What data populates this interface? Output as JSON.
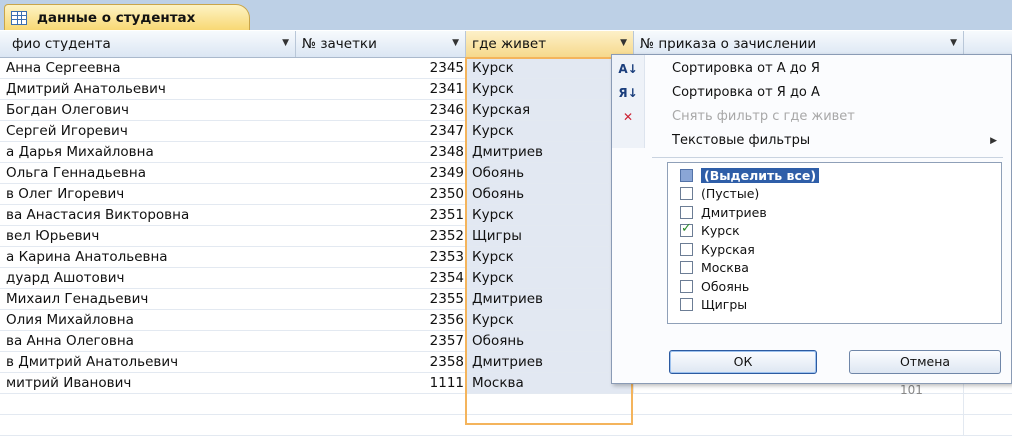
{
  "tab": {
    "label": "данные о студентах"
  },
  "columns": {
    "name": "фио студента",
    "number": "№ зачетки",
    "city": "где живет",
    "order": "№ приказа о зачислении"
  },
  "rows": [
    {
      "name": "Анна Сергеевна",
      "number": "2345",
      "city": "Курск"
    },
    {
      "name": "Дмитрий Анатольевич",
      "number": "2341",
      "city": "Курск"
    },
    {
      "name": " Богдан Олегович",
      "number": "2346",
      "city": "Курская"
    },
    {
      "name": "Сергей Игоревич",
      "number": "2347",
      "city": "Курск"
    },
    {
      "name": "а Дарья Михайловна",
      "number": "2348",
      "city": "Дмитриев"
    },
    {
      "name": "Ольга Геннадьевна",
      "number": "2349",
      "city": "Обоянь"
    },
    {
      "name": "в Олег Игоревич",
      "number": "2350",
      "city": "Обоянь"
    },
    {
      "name": "ва Анастасия Викторовна",
      "number": "2351",
      "city": "Курск"
    },
    {
      "name": "вел Юрьевич",
      "number": "2352",
      "city": "Щигры"
    },
    {
      "name": "а Карина Анатольевна",
      "number": "2353",
      "city": "Курск"
    },
    {
      "name": "дуард Ашотович",
      "number": "2354",
      "city": "Курск"
    },
    {
      "name": "Михаил Генадьевич",
      "number": "2355",
      "city": "Дмитриев"
    },
    {
      "name": "Олия Михайловна",
      "number": "2356",
      "city": "Курск"
    },
    {
      "name": "ва Анна Олеговна",
      "number": "2357",
      "city": "Обоянь"
    },
    {
      "name": "в Дмитрий Анатольевич",
      "number": "2358",
      "city": "Дмитриев"
    },
    {
      "name": "митрий Иванович",
      "number": "1111",
      "city": "Москва"
    }
  ],
  "menu": {
    "sort_asc": "Сортировка от А до Я",
    "sort_desc": "Сортировка от Я до А",
    "clear_filter": "Снять фильтр с где живет",
    "text_filters": "Текстовые фильтры",
    "sort_asc_icon": "sort-ascending-icon",
    "sort_desc_icon": "sort-descending-icon",
    "clear_filter_icon": "clear-filter-icon"
  },
  "filter_options": [
    {
      "label": "(Выделить все)",
      "state": "partial",
      "selected": true
    },
    {
      "label": "(Пустые)",
      "state": "unchecked"
    },
    {
      "label": "Дмитриев",
      "state": "unchecked"
    },
    {
      "label": "Курск",
      "state": "checked"
    },
    {
      "label": "Курская",
      "state": "unchecked"
    },
    {
      "label": "Москва",
      "state": "unchecked"
    },
    {
      "label": "Обоянь",
      "state": "unchecked"
    },
    {
      "label": "Щигры",
      "state": "unchecked"
    }
  ],
  "buttons": {
    "ok": "ОК",
    "cancel": "Отмена"
  },
  "partial_order_value": "101",
  "colors": {
    "accent": "#f4b45c",
    "header": "#dbe6f3",
    "selection": "#2f5ea8"
  }
}
